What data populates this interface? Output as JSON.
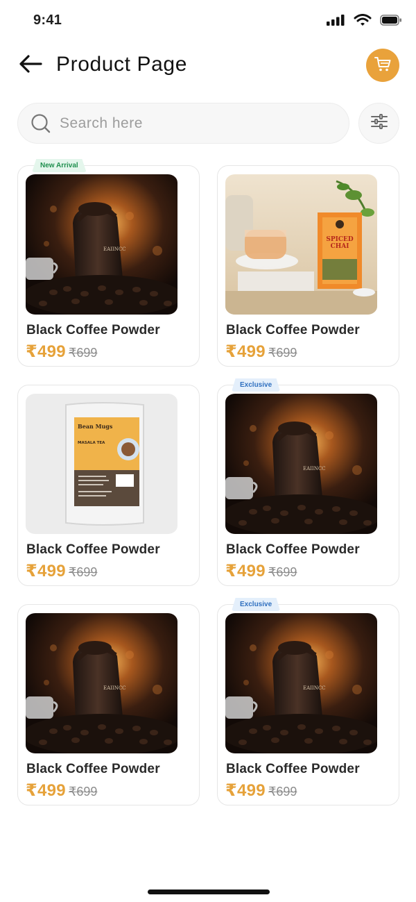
{
  "status": {
    "time": "9:41"
  },
  "header": {
    "title": "Product Page"
  },
  "search": {
    "placeholder": "Search here"
  },
  "colors": {
    "accent": "#e9a23b",
    "price": "#e6a23a",
    "badge_green": "#1f8f4e",
    "badge_blue": "#2f6fbf"
  },
  "products": [
    {
      "name": "Black Coffee Powder",
      "price": "₹499",
      "mrp": "₹699",
      "badge": "New Arrival",
      "image": "coffee-bag"
    },
    {
      "name": "Black Coffee Powder",
      "price": "₹499",
      "mrp": "₹699",
      "badge": "",
      "image": "spiced-chai"
    },
    {
      "name": "Black Coffee Powder",
      "price": "₹499",
      "mrp": "₹699",
      "badge": "",
      "image": "masala-tea-pack"
    },
    {
      "name": "Black Coffee Powder",
      "price": "₹499",
      "mrp": "₹699",
      "badge": "Exclusive",
      "image": "coffee-bag"
    },
    {
      "name": "Black Coffee Powder",
      "price": "₹499",
      "mrp": "₹699",
      "badge": "",
      "image": "coffee-bag"
    },
    {
      "name": "Black Coffee Powder",
      "price": "₹499",
      "mrp": "₹699",
      "badge": "Exclusive",
      "image": "coffee-bag"
    }
  ]
}
